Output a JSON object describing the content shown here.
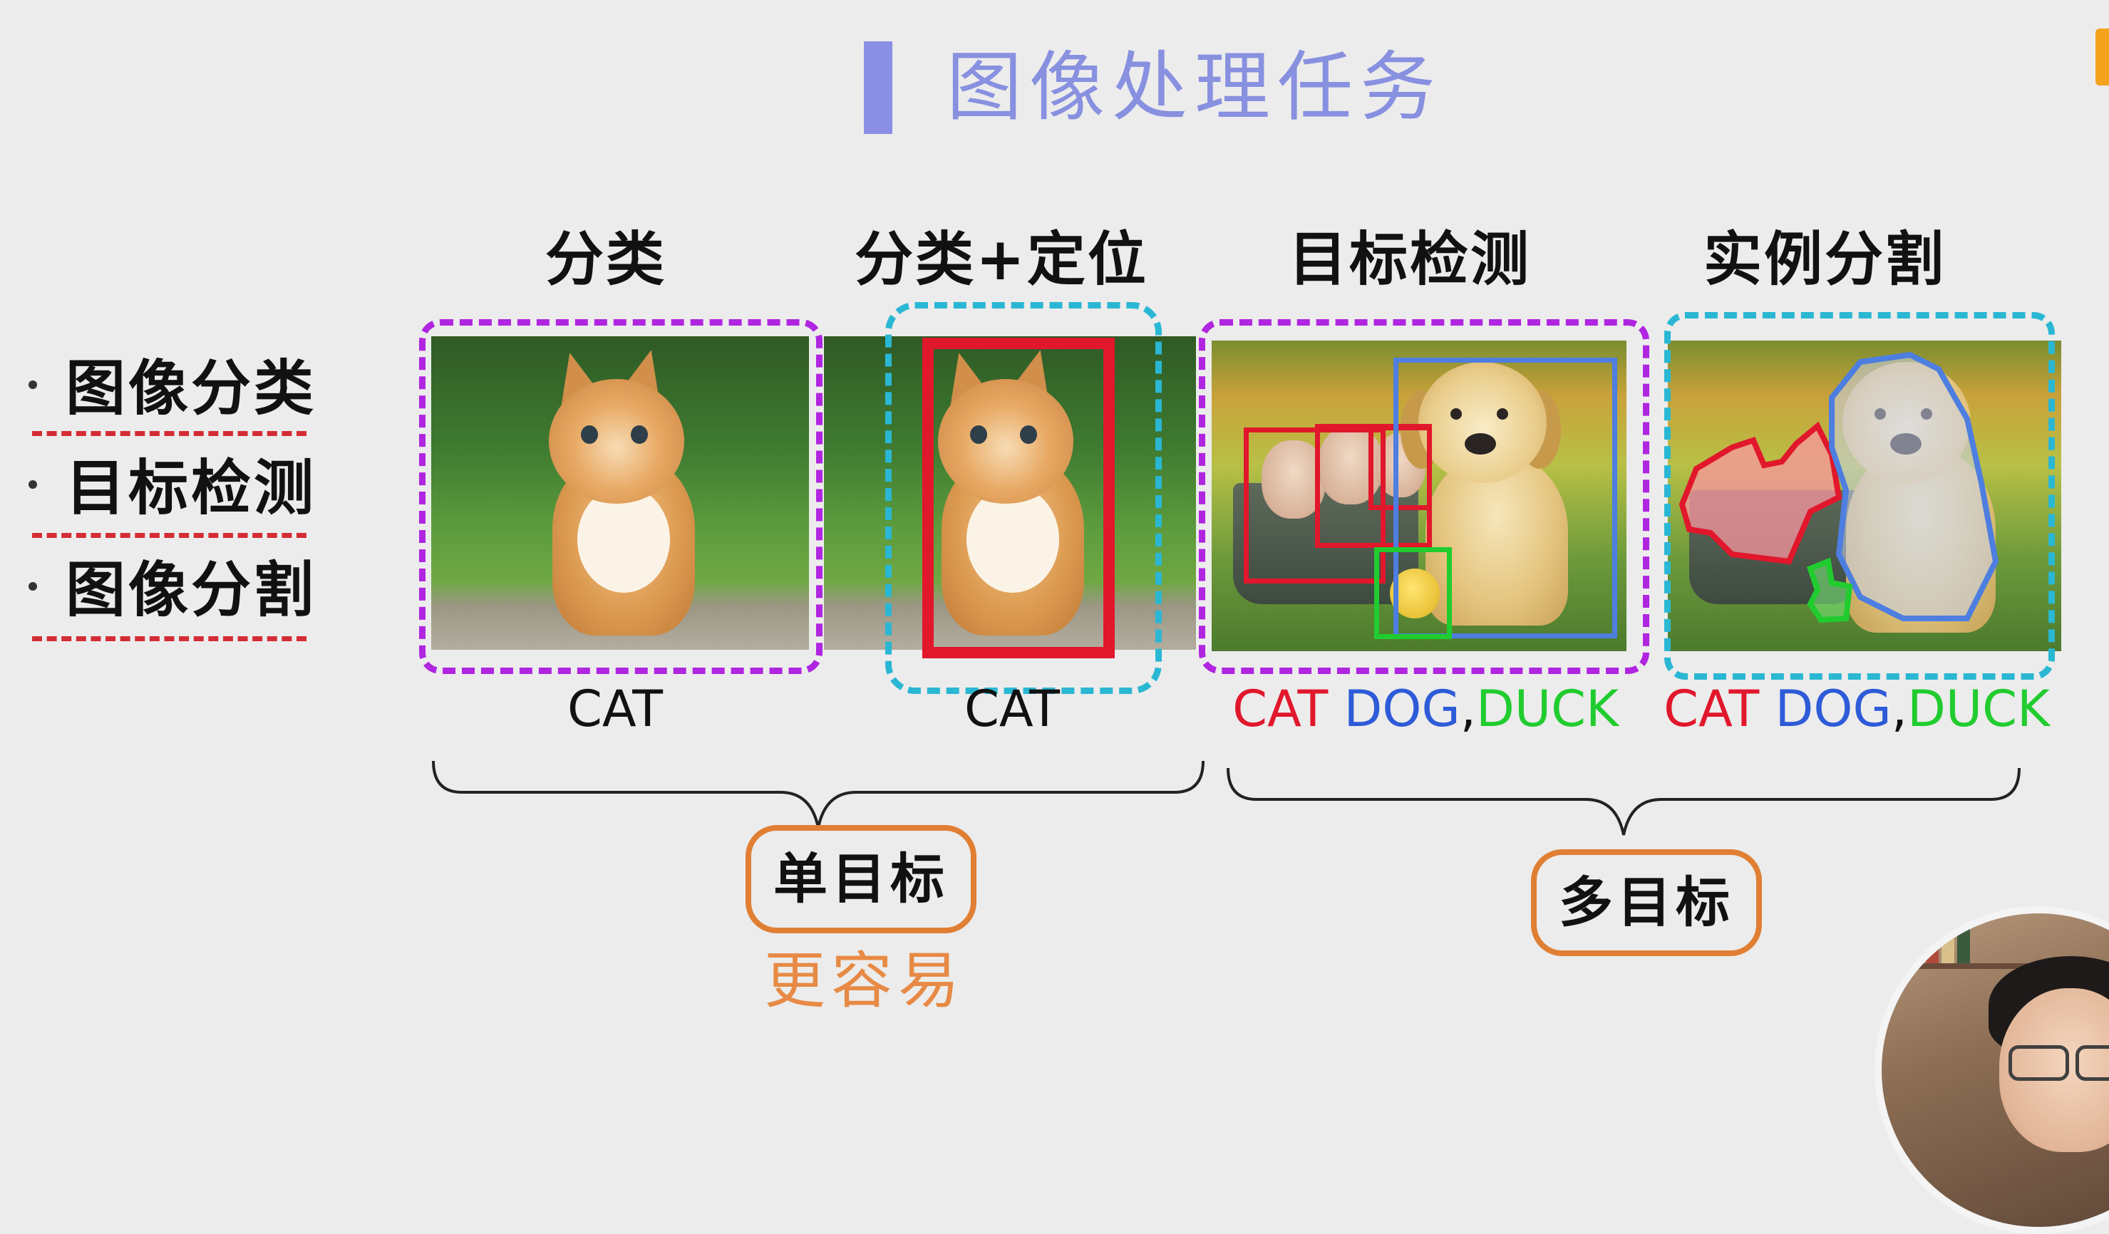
{
  "title": "图像处理任务",
  "task_list": [
    {
      "label": "图像分类"
    },
    {
      "label": "目标检测"
    },
    {
      "label": "图像分割"
    }
  ],
  "columns": [
    {
      "heading": "分类",
      "labels": [
        {
          "text": "CAT",
          "color": "#111111"
        }
      ]
    },
    {
      "heading": "分类+定位",
      "labels": [
        {
          "text": "CAT",
          "color": "#111111"
        }
      ]
    },
    {
      "heading": "目标检测",
      "labels": [
        {
          "text": "CAT",
          "color": "#e1172c"
        },
        {
          "text": " DOG",
          "color": "#2e5bd8"
        },
        {
          "text": ",",
          "color": "#111111"
        },
        {
          "text": "DUCK",
          "color": "#21cc2f"
        }
      ]
    },
    {
      "heading": "实例分割",
      "labels": [
        {
          "text": "CAT",
          "color": "#e1172c"
        },
        {
          "text": " DOG",
          "color": "#2e5bd8"
        },
        {
          "text": ",",
          "color": "#111111"
        },
        {
          "text": "DUCK",
          "color": "#21cc2f"
        }
      ]
    }
  ],
  "groups": {
    "single": {
      "label": "单目标",
      "note": "更容易"
    },
    "multi": {
      "label": "多目标"
    }
  },
  "colors": {
    "title": "#8890e0",
    "frame_purple": "#b025e0",
    "frame_cyan": "#2ab7d3",
    "box_red": "#e1172c",
    "box_blue": "#4d7ee0",
    "box_green": "#21cc2f",
    "accent_orange": "#e07f33"
  }
}
